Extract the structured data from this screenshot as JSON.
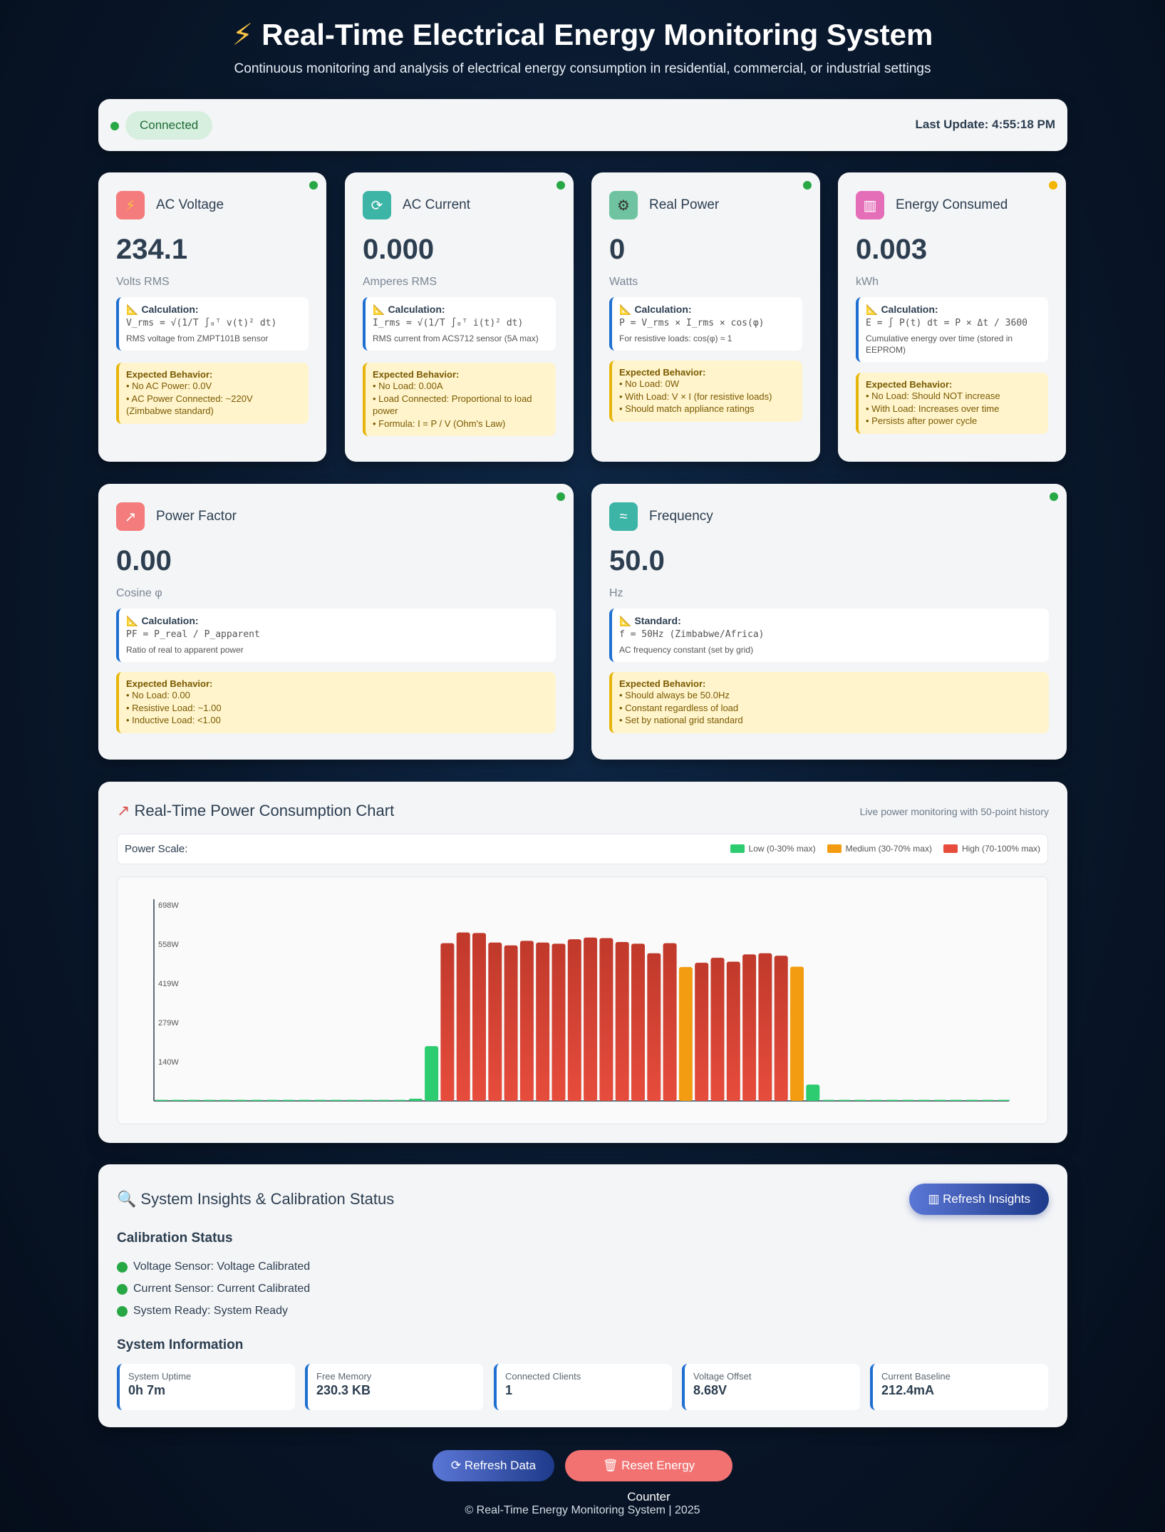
{
  "header": {
    "title": "Real-Time Electrical Energy Monitoring System",
    "subtitle": "Continuous monitoring and analysis of electrical energy consumption in residential, commercial, or industrial settings"
  },
  "status": {
    "connection": "Connected",
    "last_update": "Last Update: 4:55:18 PM"
  },
  "metrics": {
    "voltage": {
      "title": "AC Voltage",
      "value": "234.1",
      "unit": "Volts RMS",
      "calc_label": "Calculation:",
      "formula": "V_rms = √(1/T ∫₀ᵀ v(t)² dt)",
      "note": "RMS voltage from ZMPT101B sensor",
      "exp_label": "Expected Behavior:",
      "exp": [
        "• No AC Power: 0.0V",
        "• AC Power Connected: ~220V (Zimbabwe standard)"
      ],
      "icon": "lightning-icon",
      "status_color": "#28a745"
    },
    "current": {
      "title": "AC Current",
      "value": "0.000",
      "unit": "Amperes RMS",
      "calc_label": "Calculation:",
      "formula": "I_rms = √(1/T ∫₀ᵀ i(t)² dt)",
      "note": "RMS current from ACS712 sensor (5A max)",
      "exp_label": "Expected Behavior:",
      "exp": [
        "• No Load: 0.00A",
        "• Load Connected: Proportional to load power",
        "• Formula: I = P / V (Ohm's Law)"
      ],
      "icon": "refresh-icon",
      "status_color": "#28a745"
    },
    "power": {
      "title": "Real Power",
      "value": "0",
      "unit": "Watts",
      "calc_label": "Calculation:",
      "formula": "P = V_rms × I_rms × cos(φ)",
      "note": "For resistive loads: cos(φ) ≈ 1",
      "exp_label": "Expected Behavior:",
      "exp": [
        "• No Load: 0W",
        "• With Load: V × I (for resistive loads)",
        "• Should match appliance ratings"
      ],
      "icon": "gear-icon",
      "status_color": "#28a745"
    },
    "energy": {
      "title": "Energy Consumed",
      "value": "0.003",
      "unit": "kWh",
      "calc_label": "Calculation:",
      "formula": "E = ∫ P(t) dt = P × Δt / 3600",
      "note": "Cumulative energy over time (stored in EEPROM)",
      "exp_label": "Expected Behavior:",
      "exp": [
        "• No Load: Should NOT increase",
        "• With Load: Increases over time",
        "• Persists after power cycle"
      ],
      "icon": "bar-chart-icon",
      "status_color": "#f4b400"
    },
    "pf": {
      "title": "Power Factor",
      "value": "0.00",
      "unit": "Cosine φ",
      "calc_label": "Calculation:",
      "formula": "PF = P_real / P_apparent",
      "note": "Ratio of real to apparent power",
      "exp_label": "Expected Behavior:",
      "exp": [
        "• No Load: 0.00",
        "• Resistive Load: ~1.00",
        "• Inductive Load: <1.00"
      ],
      "icon": "trend-chart-icon",
      "status_color": "#28a745"
    },
    "freq": {
      "title": "Frequency",
      "value": "50.0",
      "unit": "Hz",
      "calc_label": "Standard:",
      "formula": "f = 50Hz (Zimbabwe/Africa)",
      "note": "AC frequency constant (set by grid)",
      "exp_label": "Expected Behavior:",
      "exp": [
        "• Should always be 50.0Hz",
        "• Constant regardless of load",
        "• Set by national grid standard"
      ],
      "icon": "wave-icon",
      "status_color": "#28a745"
    }
  },
  "chart": {
    "title": "Real-Time Power Consumption Chart",
    "description": "Live power monitoring with 50-point history",
    "scale_label": "Power Scale:",
    "legend": [
      {
        "label": "Low (0-30% max)",
        "color": "#2ecc71"
      },
      {
        "label": "Medium (30-70% max)",
        "color": "#f39c12"
      },
      {
        "label": "High (70-100% max)",
        "color": "#e74c3c"
      }
    ]
  },
  "chart_data": {
    "type": "bar",
    "title": "Real-Time Power Consumption Chart",
    "xlabel": "",
    "ylabel": "",
    "ylim": [
      0,
      698
    ],
    "yticks": [
      "140W",
      "279W",
      "419W",
      "558W",
      "698W"
    ],
    "ytick_values": [
      140,
      279,
      419,
      558,
      698
    ],
    "values": [
      0,
      0,
      0,
      0,
      0,
      0,
      0,
      0,
      0,
      0,
      0,
      0,
      0,
      0,
      0,
      0,
      8,
      195,
      562,
      600,
      598,
      564,
      554,
      570,
      564,
      560,
      576,
      582,
      580,
      566,
      560,
      526,
      562,
      477,
      492,
      510,
      496,
      522,
      526,
      517,
      478,
      58,
      1,
      0,
      0,
      0,
      0,
      0,
      0,
      0,
      0,
      0,
      0,
      0
    ],
    "grid": false
  },
  "insights": {
    "title": "System Insights & Calibration Status",
    "refresh_label": "Refresh Insights",
    "calibration_head": "Calibration Status",
    "calibration": [
      "Voltage Sensor: Voltage Calibrated",
      "Current Sensor: Current Calibrated",
      "System Ready: System Ready"
    ],
    "system_head": "System Information",
    "system": [
      {
        "label": "System Uptime",
        "value": "0h 7m"
      },
      {
        "label": "Free Memory",
        "value": "230.3 KB"
      },
      {
        "label": "Connected Clients",
        "value": "1"
      },
      {
        "label": "Voltage Offset",
        "value": "8.68V"
      },
      {
        "label": "Current Baseline",
        "value": "212.4mA"
      }
    ]
  },
  "actions": {
    "refresh_data": "Refresh Data",
    "reset_energy": "Reset Energy Counter"
  },
  "footer": "© Real-Time Energy Monitoring System | 2025"
}
